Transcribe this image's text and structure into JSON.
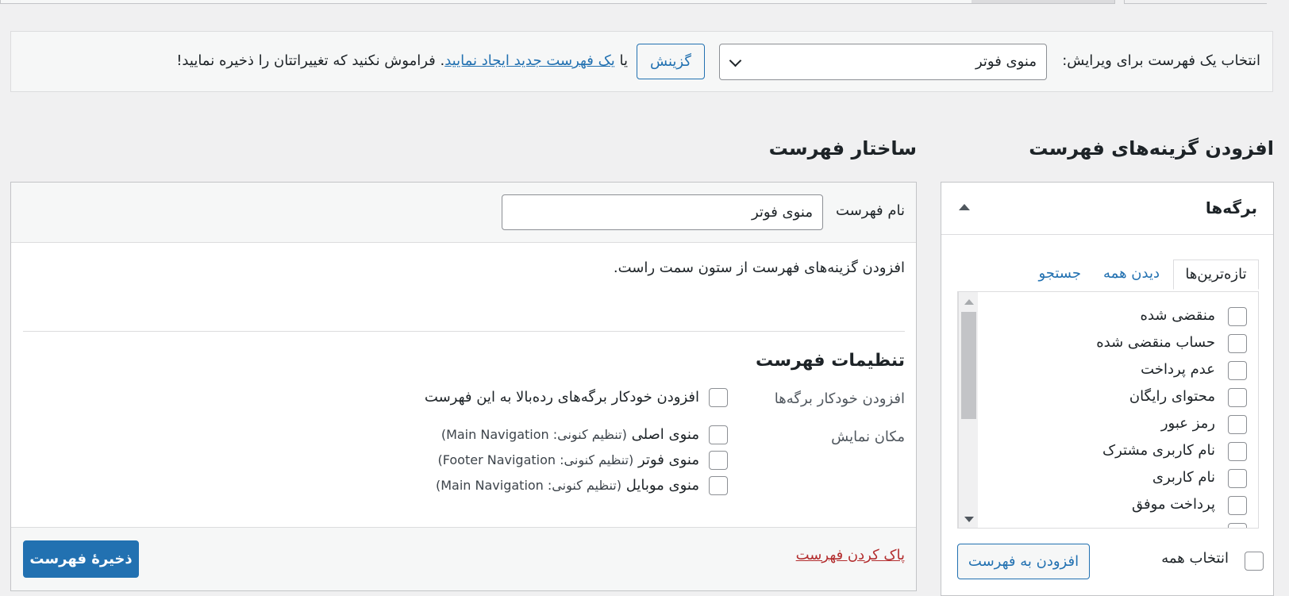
{
  "manage": {
    "label": "انتخاب یک فهرست برای ویرایش:",
    "selected_menu": "منوی فوتر",
    "choose_button": "گزینش",
    "or_text": "یا",
    "create_link": "یک فهرست جدید ایجاد نمایید",
    "reminder": ". فراموش نکنید که تغییراتتان را ذخیره نمایید!"
  },
  "headings": {
    "add_items": "افزودن گزینه‌های فهرست",
    "structure": "ساختار فهرست"
  },
  "pages_box": {
    "title": "برگه‌ها",
    "tabs": [
      "تازه‌ترین‌ها",
      "دیدن همه",
      "جستجو"
    ],
    "items": [
      "منقضی شده",
      "حساب منقضی شده",
      "عدم پرداخت",
      "محتوای رایگان",
      "رمز عبور",
      "نام کاربری مشترک",
      "نام کاربری",
      "پرداخت موفق"
    ],
    "select_all": "انتخاب همه",
    "add_button": "افزودن به فهرست"
  },
  "structure": {
    "name_label": "نام فهرست",
    "name_value": "منوی فوتر",
    "instructions": "افزودن گزینه‌های فهرست از ستون سمت راست.",
    "settings_heading": "تنظیمات فهرست",
    "auto_add_label": "افزودن خودکار برگه‌ها",
    "auto_add_option": "افزودن خودکار برگه‌های رده‌بالا به این فهرست",
    "location_label": "مکان نمایش",
    "locations": [
      {
        "name": "منوی اصلی",
        "current": "(تنظیم کنونی: Main Navigation)"
      },
      {
        "name": "منوی فوتر",
        "current": "(تنظیم کنونی: Footer Navigation)"
      },
      {
        "name": "منوی موبایل",
        "current": "(تنظیم کنونی: Main Navigation)"
      }
    ],
    "delete_link": "پاک کردن فهرست",
    "save_button": "ذخیرهٔ فهرست"
  }
}
